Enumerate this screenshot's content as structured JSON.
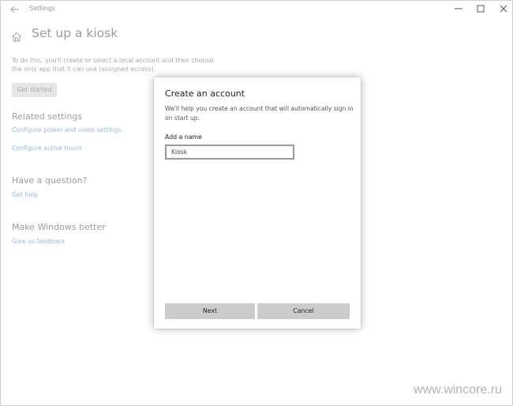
{
  "window": {
    "title": "Settings"
  },
  "page": {
    "title": "Set up a kiosk",
    "description": "To do this, you'll create or select a local account and then choose the only app that it can use (assigned access).",
    "get_started_label": "Get started"
  },
  "related_settings": {
    "heading": "Related settings",
    "links": [
      "Configure power and sleep settings",
      "Configure active hours"
    ]
  },
  "question": {
    "heading": "Have a question?",
    "link": "Get help"
  },
  "better": {
    "heading": "Make Windows better",
    "link": "Give us feedback"
  },
  "dialog": {
    "title": "Create an account",
    "description": "We'll help you create an account that will automatically sign in on start up.",
    "field_label": "Add a name",
    "name_value": "Kiosk",
    "next_label": "Next",
    "cancel_label": "Cancel"
  },
  "watermark": "www.wincore.ru",
  "colors": {
    "link": "#8fbcea",
    "button_disabled": "#e6e6e6",
    "dialog_button": "#cccccc"
  },
  "icons": [
    "back-arrow-icon",
    "minimize-icon",
    "maximize-icon",
    "close-icon",
    "home-icon"
  ]
}
